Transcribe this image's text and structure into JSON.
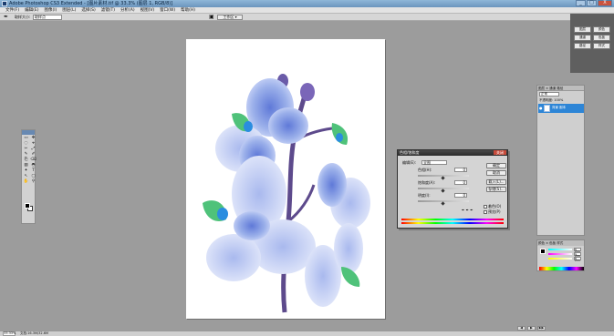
{
  "window": {
    "title": "Adobe Photoshop CS3 Extended - [图片素材.tif @ 33.3% (图层 1, RGB/8)]"
  },
  "window_controls": {
    "minimize": "_",
    "maximize": "□",
    "close": "X"
  },
  "menu": [
    "文件(F)",
    "编辑(E)",
    "图像(I)",
    "图层(L)",
    "选择(S)",
    "滤镜(T)",
    "分析(A)",
    "视图(V)",
    "窗口(W)",
    "帮助(H)"
  ],
  "options_bar": {
    "tool_icon": "eyedropper-icon",
    "sample_label": "取样大小:",
    "sample_value": "取样点",
    "workspace_label": "工作区 ▾"
  },
  "dock": {
    "buttons": [
      "图层",
      "通道",
      "路径",
      "颜色",
      "色板",
      "样式"
    ]
  },
  "toolbox": {
    "tools": [
      "▭",
      "✥",
      "◌",
      "⌖",
      "✂",
      "⤢",
      "✎",
      "✐",
      "⎘",
      "⌫",
      "▨",
      "◓",
      "✦",
      "T",
      "↖",
      "▢",
      "✋",
      "⚲"
    ]
  },
  "dialog": {
    "title": "色相/饱和度",
    "close": "关闭",
    "edit_label": "编辑(E):",
    "edit_value": "全图",
    "hue_label": "色相(H):",
    "hue_value": "0",
    "saturation_label": "饱和度(A):",
    "saturation_value": "0",
    "lightness_label": "明度(I):",
    "lightness_value": "0",
    "buttons": {
      "ok": "确定",
      "cancel": "取消",
      "load": "载入(L)...",
      "save": "存储(S)..."
    },
    "colorize_label": "着色(O)",
    "preview_label": "预览(P)"
  },
  "layers_panel": {
    "tabs": "图层 × 通道 路径",
    "mode": "正常",
    "opacity": "不透明度: 100%",
    "layer_name": "背景 副本"
  },
  "color_panel": {
    "tabs": "颜色 × 色板 样式",
    "values": [
      "R 255",
      "G 255",
      "B 255"
    ]
  },
  "nav": [
    "◀",
    "▶",
    "▶▶"
  ],
  "status": {
    "zoom": "33.33%",
    "doc": "文档:16.3M/32.6M"
  },
  "colors": {
    "accent": "#2d85d6",
    "workspace": "#9c9c9c",
    "petal": "#8fa6e6",
    "stem": "#5d4a8c",
    "leaf": "#4fc27a"
  }
}
